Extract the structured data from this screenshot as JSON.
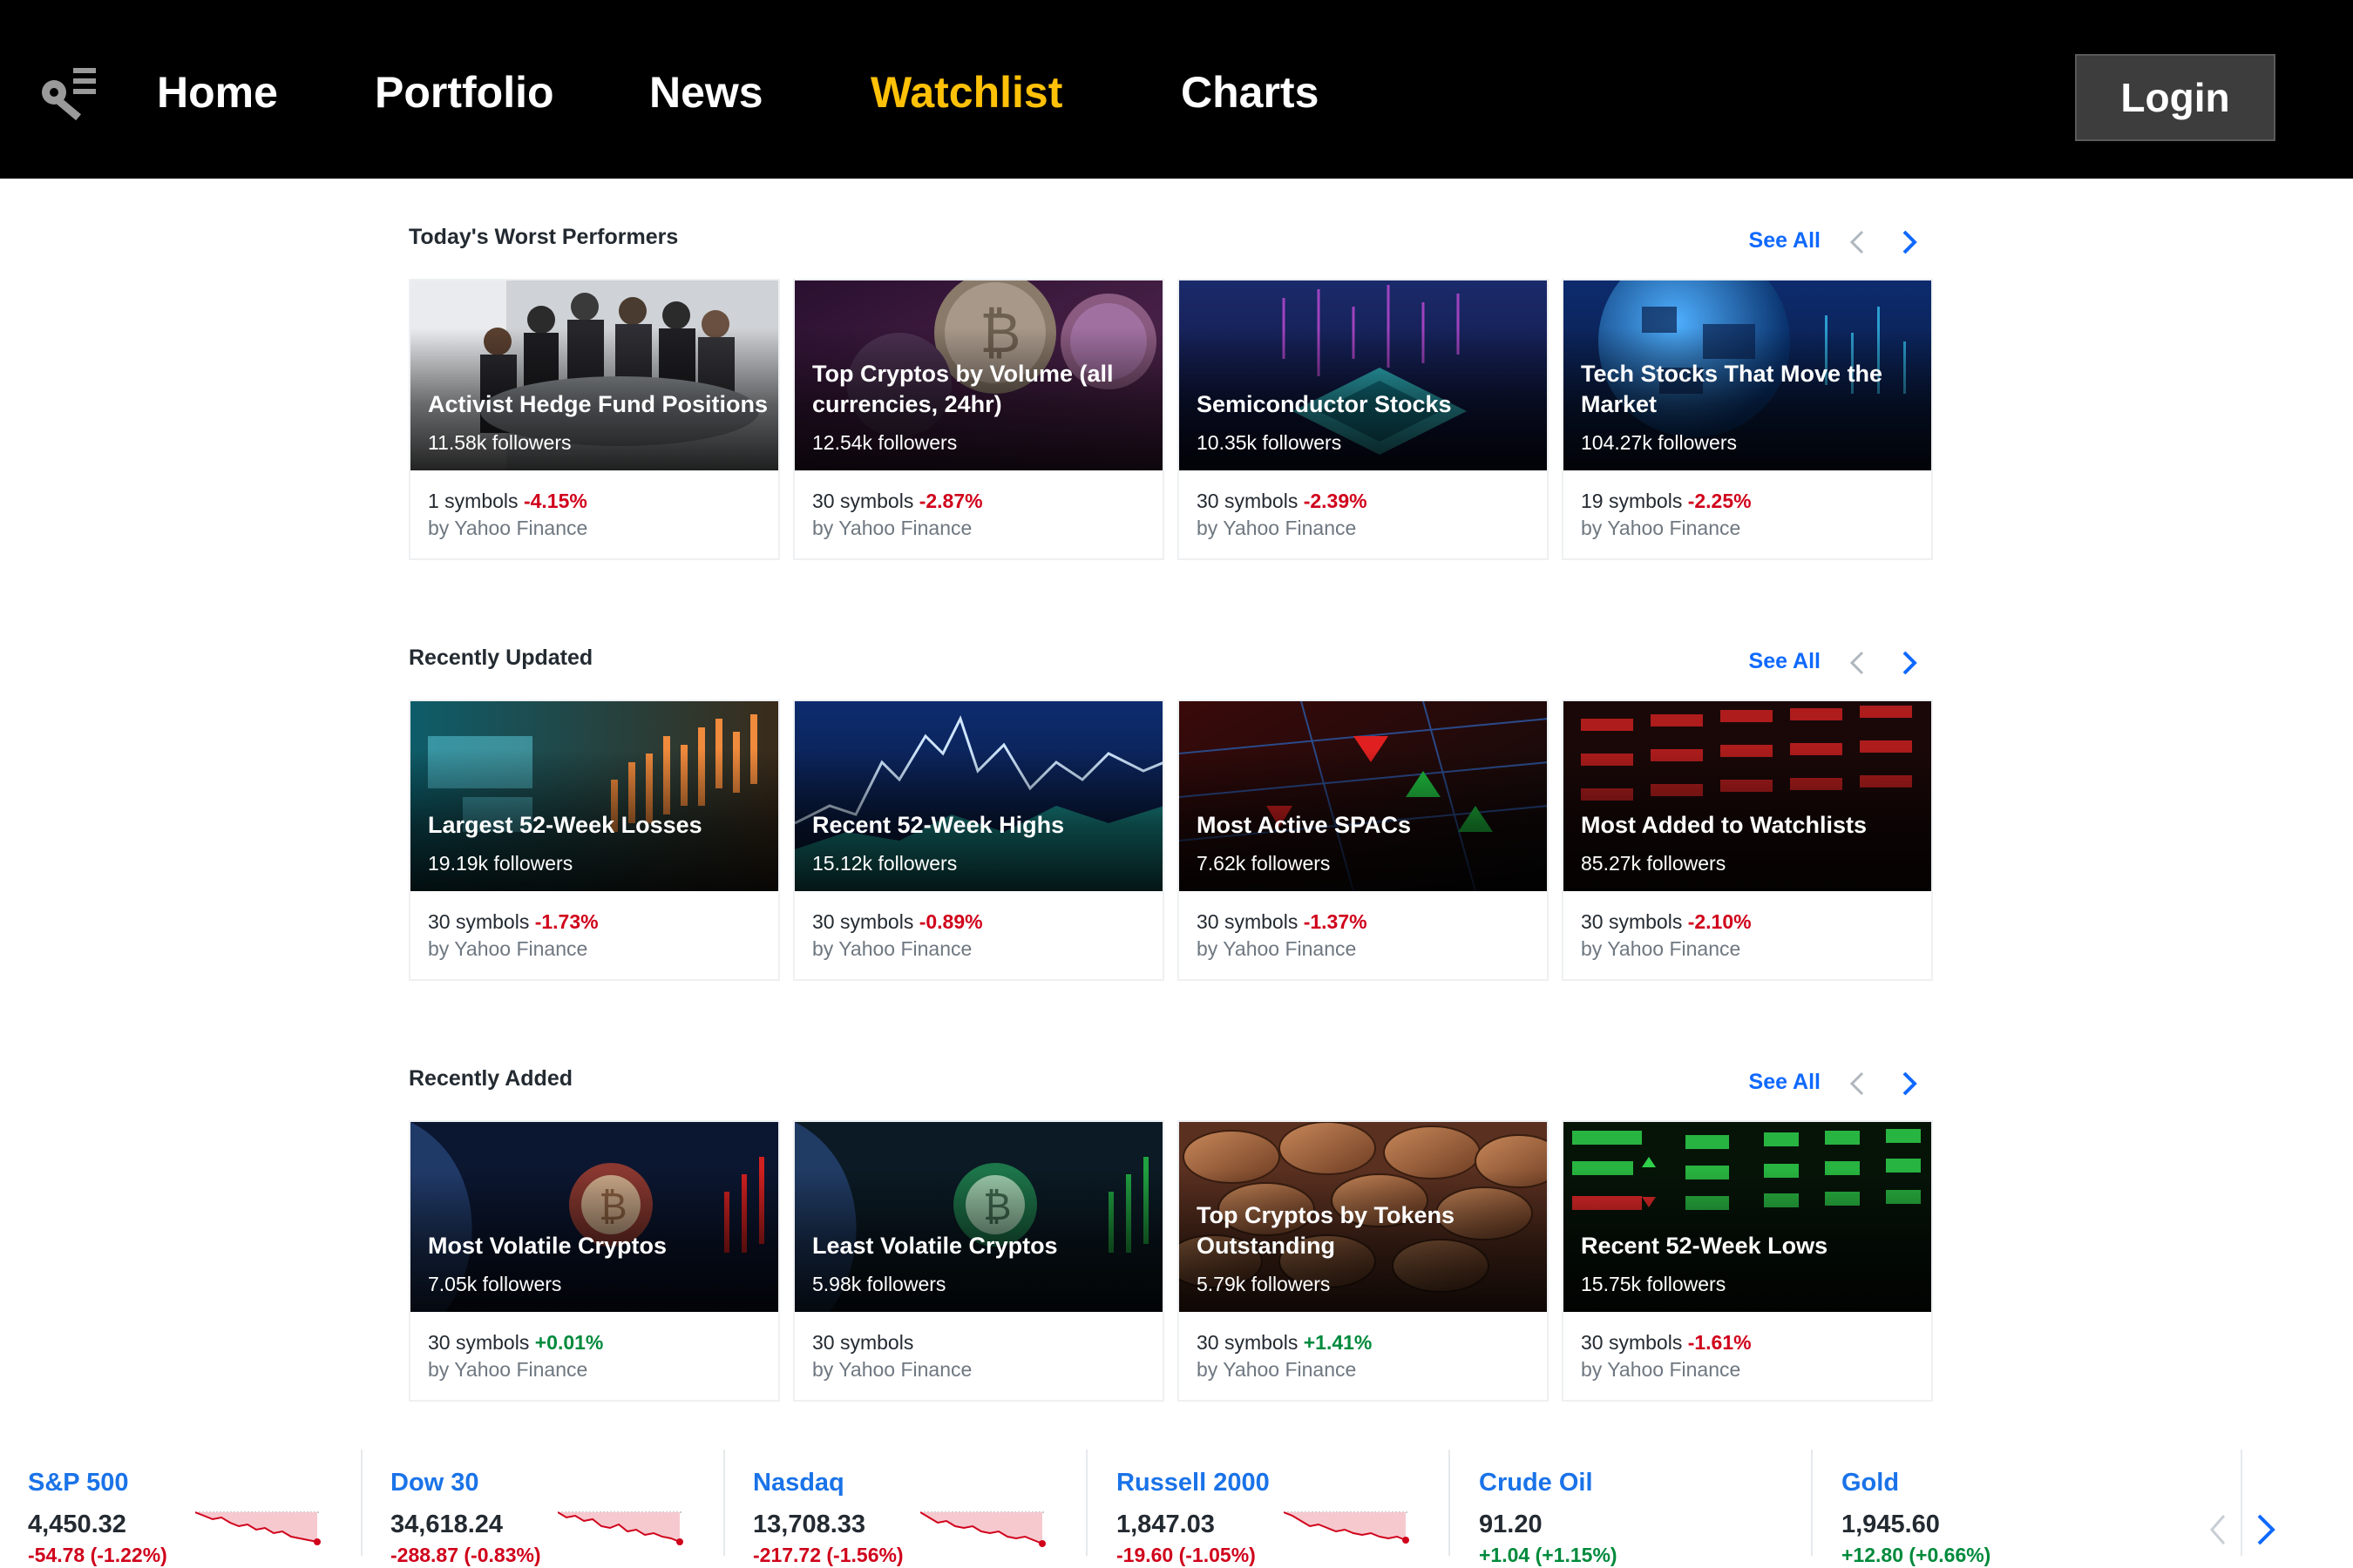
{
  "nav": {
    "items": [
      {
        "label": "Home",
        "active": false
      },
      {
        "label": "Portfolio",
        "active": false
      },
      {
        "label": "News",
        "active": false
      },
      {
        "label": "Watchlist",
        "active": true
      },
      {
        "label": "Charts",
        "active": false
      }
    ],
    "login_label": "Login"
  },
  "sections": [
    {
      "title": "Today's Worst Performers",
      "see_all": "See All",
      "cards": [
        {
          "title": "Activist Hedge Fund Positions",
          "followers": "11.58k followers",
          "symbols": "1 symbols",
          "change": "-4.15%",
          "direction": "neg",
          "by": "by Yahoo Finance",
          "image": "business-meeting"
        },
        {
          "title": "Top Cryptos by Volume (all currencies, 24hr)",
          "followers": "12.54k followers",
          "symbols": "30 symbols",
          "change": "-2.87%",
          "direction": "neg",
          "by": "by Yahoo Finance",
          "image": "bitcoin-coins"
        },
        {
          "title": "Semiconductor Stocks",
          "followers": "10.35k followers",
          "symbols": "30 symbols",
          "change": "-2.39%",
          "direction": "neg",
          "by": "by Yahoo Finance",
          "image": "microchip"
        },
        {
          "title": "Tech Stocks That Move the Market",
          "followers": "104.27k followers",
          "symbols": "19 symbols",
          "change": "-2.25%",
          "direction": "neg",
          "by": "by Yahoo Finance",
          "image": "digital-globe"
        }
      ]
    },
    {
      "title": "Recently Updated",
      "see_all": "See All",
      "cards": [
        {
          "title": "Largest 52-Week Losses",
          "followers": "19.19k followers",
          "symbols": "30 symbols",
          "change": "-1.73%",
          "direction": "neg",
          "by": "by Yahoo Finance",
          "image": "candlestick-map"
        },
        {
          "title": "Recent 52-Week Highs",
          "followers": "15.12k followers",
          "symbols": "30 symbols",
          "change": "-0.89%",
          "direction": "neg",
          "by": "by Yahoo Finance",
          "image": "line-chart"
        },
        {
          "title": "Most Active SPACs",
          "followers": "7.62k followers",
          "symbols": "30 symbols",
          "change": "-1.37%",
          "direction": "neg",
          "by": "by Yahoo Finance",
          "image": "stock-board-arrows"
        },
        {
          "title": "Most Added to Watchlists",
          "followers": "85.27k followers",
          "symbols": "30 symbols",
          "change": "-2.10%",
          "direction": "neg",
          "by": "by Yahoo Finance",
          "image": "stock-board-numbers"
        }
      ]
    },
    {
      "title": "Recently Added",
      "see_all": "See All",
      "cards": [
        {
          "title": "Most Volatile Cryptos",
          "followers": "7.05k followers",
          "symbols": "30 symbols",
          "change": "+0.01%",
          "direction": "pos",
          "by": "by Yahoo Finance",
          "image": "crypto-red"
        },
        {
          "title": "Least Volatile Cryptos",
          "followers": "5.98k followers",
          "symbols": "30 symbols",
          "change": "",
          "direction": "pos",
          "by": "by Yahoo Finance",
          "image": "crypto-green"
        },
        {
          "title": "Top Cryptos by Tokens Outstanding",
          "followers": "5.79k followers",
          "symbols": "30 symbols",
          "change": "+1.41%",
          "direction": "pos",
          "by": "by Yahoo Finance",
          "image": "coin-pile"
        },
        {
          "title": "Recent 52-Week Lows",
          "followers": "15.75k followers",
          "symbols": "30 symbols",
          "change": "-1.61%",
          "direction": "neg",
          "by": "by Yahoo Finance",
          "image": "green-quote-board"
        }
      ]
    }
  ],
  "ticker": [
    {
      "name": "S&P 500",
      "price": "4,450.32",
      "change": "-54.78 (-1.22%)",
      "direction": "neg"
    },
    {
      "name": "Dow 30",
      "price": "34,618.24",
      "change": "-288.87 (-0.83%)",
      "direction": "neg"
    },
    {
      "name": "Nasdaq",
      "price": "13,708.33",
      "change": "-217.72 (-1.56%)",
      "direction": "neg"
    },
    {
      "name": "Russell 2000",
      "price": "1,847.03",
      "change": "-19.60 (-1.05%)",
      "direction": "neg"
    },
    {
      "name": "Crude Oil",
      "price": "91.20",
      "change": "+1.04 (+1.15%)",
      "direction": "pos"
    },
    {
      "name": "Gold",
      "price": "1,945.60",
      "change": "+12.80 (+0.66%)",
      "direction": "pos"
    }
  ],
  "colors": {
    "accent_nav": "#ffc107",
    "link": "#0f69ff",
    "negative": "#d0021b",
    "positive": "#008a3c"
  }
}
